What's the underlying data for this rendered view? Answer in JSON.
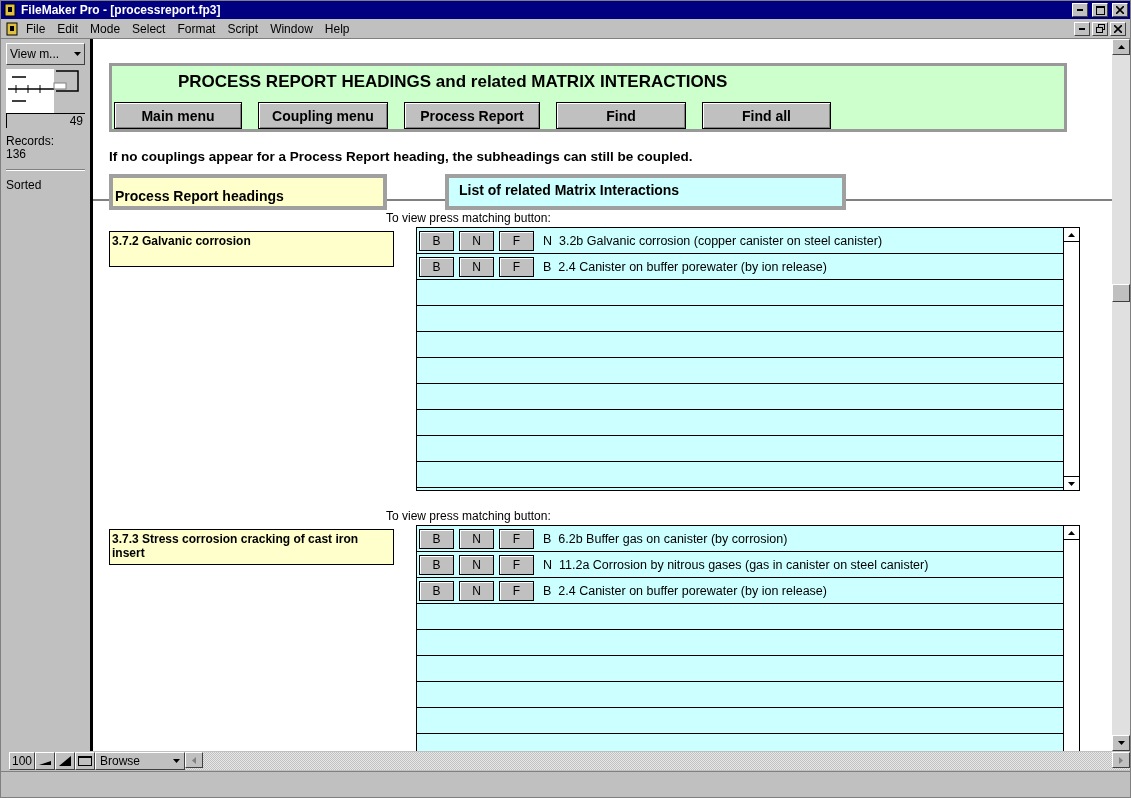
{
  "window": {
    "title": "FileMaker Pro - [processreport.fp3]"
  },
  "menu": [
    "File",
    "Edit",
    "Mode",
    "Select",
    "Format",
    "Script",
    "Window",
    "Help"
  ],
  "status_area": {
    "layout_menu": "View m...",
    "record_number": "49",
    "records_label": "Records:",
    "records_count": "136",
    "sort_state": "Sorted"
  },
  "header": {
    "title": "PROCESS REPORT HEADINGS and related MATRIX INTERACTIONS",
    "buttons": [
      "Main menu",
      "Coupling menu",
      "Process Report",
      "Find",
      "Find all"
    ]
  },
  "instruction": "If no couplings appear for a Process Report heading, the subheadings can still be coupled.",
  "column_headings": [
    "Process Report headings",
    "List of related Matrix Interactions"
  ],
  "records": [
    {
      "heading": "3.7.2 Galvanic corrosion",
      "portal_label": "To view press matching button:",
      "interactions": [
        {
          "buttons": [
            "B",
            "N",
            "F"
          ],
          "code": "N",
          "text": "3.2b Galvanic corrosion (copper canister on steel canister)"
        },
        {
          "buttons": [
            "B",
            "N",
            "F"
          ],
          "code": "B",
          "text": "2.4 Canister on buffer porewater (by ion release)"
        }
      ]
    },
    {
      "heading": "3.7.3 Stress corrosion cracking of cast iron insert",
      "portal_label": "To view press matching button:",
      "interactions": [
        {
          "buttons": [
            "B",
            "N",
            "F"
          ],
          "code": "B",
          "text": "6.2b Buffer gas on canister (by corrosion)"
        },
        {
          "buttons": [
            "B",
            "N",
            "F"
          ],
          "code": "N",
          "text": "11.2a Corrosion by nitrous gases (gas in canister on steel canister)"
        },
        {
          "buttons": [
            "B",
            "N",
            "F"
          ],
          "code": "B",
          "text": "2.4 Canister on buffer porewater (by ion release)"
        }
      ]
    }
  ],
  "bottom_bar": {
    "zoom": "100",
    "mode": "Browse"
  }
}
